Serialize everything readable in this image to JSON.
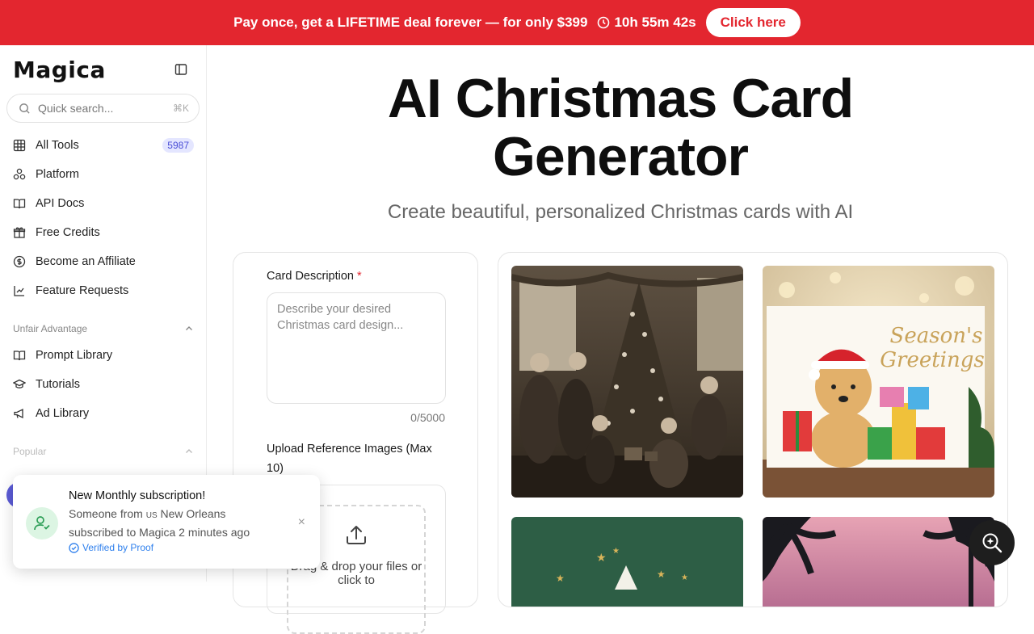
{
  "banner": {
    "text": "Pay once, get a LIFETIME deal forever — for only $399",
    "timer": "10h 55m 42s",
    "cta": "Click here"
  },
  "sidebar": {
    "logo": "Magica",
    "search": {
      "placeholder": "Quick search...",
      "shortcut": "⌘K"
    },
    "items": [
      {
        "label": "All Tools",
        "icon": "grid-icon",
        "badge": "5987"
      },
      {
        "label": "Platform",
        "icon": "platform-icon"
      },
      {
        "label": "API Docs",
        "icon": "book-icon"
      },
      {
        "label": "Free Credits",
        "icon": "gift-icon"
      },
      {
        "label": "Become an Affiliate",
        "icon": "dollar-icon"
      },
      {
        "label": "Feature Requests",
        "icon": "feature-icon"
      }
    ],
    "section_unfair": "Unfair Advantage",
    "unfair_items": [
      {
        "label": "Prompt Library",
        "icon": "book-icon"
      },
      {
        "label": "Tutorials",
        "icon": "graduation-cap-icon"
      },
      {
        "label": "Ad Library",
        "icon": "megaphone-icon"
      }
    ],
    "section_popular": "Popular"
  },
  "main": {
    "title_line1": "AI Christmas Card",
    "title_line2": "Generator",
    "subtitle": "Create beautiful, personalized Christmas cards with AI",
    "form": {
      "description_label": "Card Description",
      "required_mark": "*",
      "description_placeholder": "Describe your desired Christmas card design...",
      "counter": "0/5000",
      "upload_label": "Upload Reference Images (Max 10)",
      "dropzone_text": "Drag & drop your files or click to"
    },
    "gallery": {
      "greeting_text_1": "Season's",
      "greeting_text_2": "Greetings"
    }
  },
  "toast": {
    "title": "New Monthly subscription!",
    "body_prefix": "Someone from",
    "country": "US",
    "body_suffix": "New Orleans subscribed to Magica 2 minutes ago",
    "verified": "Verified by Proof",
    "close": "×"
  },
  "colors": {
    "brand_red": "#e3262f",
    "badge_bg": "#e4e6ff",
    "badge_text": "#4b4fd6",
    "verified_blue": "#2f80ed"
  }
}
